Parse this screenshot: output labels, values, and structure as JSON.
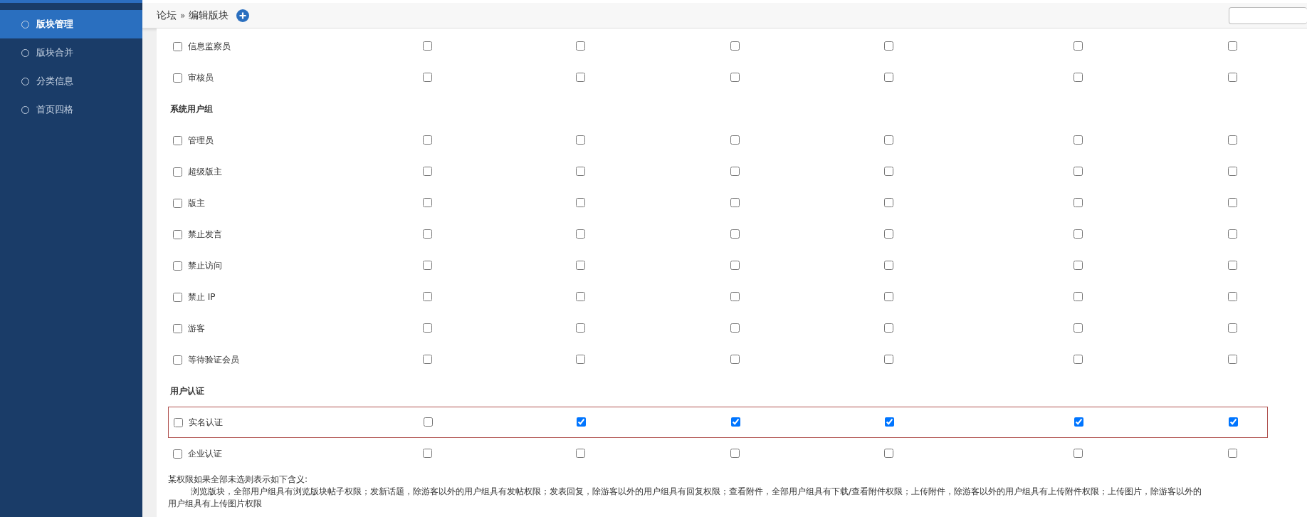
{
  "sidebar": {
    "items": [
      {
        "label": "版块管理",
        "selected": true
      },
      {
        "label": "版块合并",
        "selected": false
      },
      {
        "label": "分类信息",
        "selected": false
      },
      {
        "label": "首页四格",
        "selected": false
      }
    ]
  },
  "header": {
    "breadcrumb": [
      {
        "label": "论坛"
      },
      {
        "label": "»"
      },
      {
        "label": "编辑版块"
      }
    ]
  },
  "permissions": [
    {
      "kind": "row",
      "label": "信息监察员",
      "checked": false,
      "highlighted": false,
      "perms": [
        false,
        false,
        false,
        false,
        false,
        false
      ]
    },
    {
      "kind": "row",
      "label": "审核员",
      "checked": false,
      "highlighted": false,
      "perms": [
        false,
        false,
        false,
        false,
        false,
        false
      ]
    },
    {
      "kind": "heading",
      "label": "系统用户组"
    },
    {
      "kind": "row",
      "label": "管理员",
      "checked": false,
      "highlighted": false,
      "perms": [
        false,
        false,
        false,
        false,
        false,
        false
      ]
    },
    {
      "kind": "row",
      "label": "超级版主",
      "checked": false,
      "highlighted": false,
      "perms": [
        false,
        false,
        false,
        false,
        false,
        false
      ]
    },
    {
      "kind": "row",
      "label": "版主",
      "checked": false,
      "highlighted": false,
      "perms": [
        false,
        false,
        false,
        false,
        false,
        false
      ]
    },
    {
      "kind": "row",
      "label": "禁止发言",
      "checked": false,
      "highlighted": false,
      "perms": [
        false,
        false,
        false,
        false,
        false,
        false
      ]
    },
    {
      "kind": "row",
      "label": "禁止访问",
      "checked": false,
      "highlighted": false,
      "perms": [
        false,
        false,
        false,
        false,
        false,
        false
      ]
    },
    {
      "kind": "row",
      "label": "禁止 IP",
      "checked": false,
      "highlighted": false,
      "perms": [
        false,
        false,
        false,
        false,
        false,
        false
      ]
    },
    {
      "kind": "row",
      "label": "游客",
      "checked": false,
      "highlighted": false,
      "perms": [
        false,
        false,
        false,
        false,
        false,
        false
      ]
    },
    {
      "kind": "row",
      "label": "等待验证会员",
      "checked": false,
      "highlighted": false,
      "perms": [
        false,
        false,
        false,
        false,
        false,
        false
      ]
    },
    {
      "kind": "heading",
      "label": "用户认证"
    },
    {
      "kind": "row",
      "label": "实名认证",
      "checked": false,
      "highlighted": true,
      "perms": [
        false,
        true,
        true,
        true,
        true,
        true
      ]
    },
    {
      "kind": "row",
      "label": "企业认证",
      "checked": false,
      "highlighted": false,
      "perms": [
        false,
        false,
        false,
        false,
        false,
        false
      ]
    }
  ],
  "notes": {
    "title": "某权限如果全部未选则表示如下含义:",
    "body": "浏览版块，全部用户组具有浏览版块帖子权限；发新话题，除游客以外的用户组具有发帖权限；发表回复，除游客以外的用户组具有回复权限；查看附件，全部用户组具有下载/查看附件权限；上传附件，除游客以外的用户组具有上传附件权限；上传图片，除游客以外的用户组具有上传图片权限"
  }
}
